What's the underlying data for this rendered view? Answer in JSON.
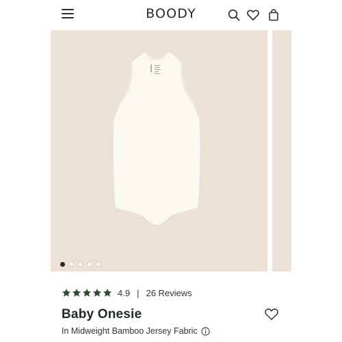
{
  "header": {
    "logo_text": "BOODY",
    "menu_icon": "hamburger-menu-icon",
    "search_icon": "search-icon",
    "wishlist_icon": "heart-icon",
    "bag_icon": "shopping-bag-icon"
  },
  "gallery": {
    "background_color": "#ebe1d7",
    "product_image": "white sleeveless baby onesie",
    "label_text": "BOODY",
    "dots": [
      {
        "active": true
      },
      {
        "active": false
      },
      {
        "active": false
      },
      {
        "active": false
      },
      {
        "active": false
      }
    ]
  },
  "product": {
    "rating_value": "4.9",
    "rating_separator": "|",
    "reviews_label": "26 Reviews",
    "stars_filled": 5,
    "star_color": "#2d4a2f",
    "title": "Baby Onesie",
    "subtitle": "In Midweight Bamboo Jersey Fabric",
    "info_icon": "info-icon",
    "wishlist_icon": "heart-outline-icon"
  }
}
